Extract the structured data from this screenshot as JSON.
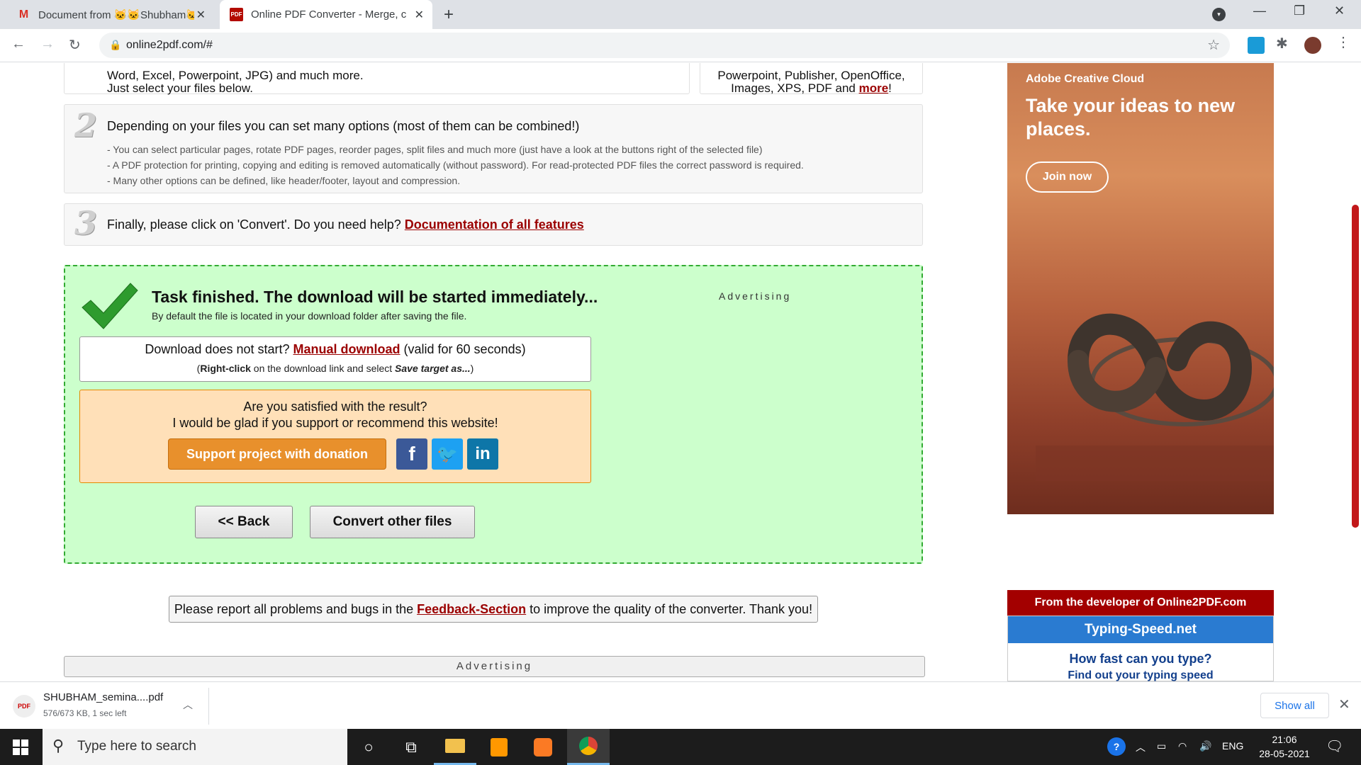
{
  "browser": {
    "tabs": [
      {
        "title": "Document from 🐱🐱Shubham🐱",
        "favicon": "M"
      },
      {
        "title": "Online PDF Converter - Merge, c",
        "favicon": "PDF"
      }
    ],
    "url": "online2pdf.com/#"
  },
  "steps": {
    "step1_line1": "Word, Excel, Powerpoint, JPG) and much more.",
    "step1_line2": "Just select your files below.",
    "step1_right_line1": "Powerpoint, Publisher, OpenOffice,",
    "step1_right_line2_prefix": "Images, XPS, PDF and ",
    "step1_right_more": "more",
    "step1_right_suffix": "!",
    "step2_num": "2",
    "step2_head": "Depending on your files you can set many options (most of them can be combined!)",
    "step2_sub1": "- You can select particular pages, rotate PDF pages, reorder pages, split files and much more (just have a look at the buttons right of the selected file)",
    "step2_sub2": "- A PDF protection for printing, copying and editing is removed automatically (without password). For read-protected PDF files the correct password is required.",
    "step2_sub3": "- Many other options can be defined, like header/footer, layout and compression.",
    "step3_num": "3",
    "step3_head": "Finally, please click on 'Convert'. Do you need help? ",
    "step3_link": "Documentation of all features"
  },
  "result": {
    "title": "Task finished. The download will be started immediately...",
    "subtitle": "By default the file is located in your download folder after saving the file.",
    "advertising": "Advertising",
    "download_prefix": "Download does not start? ",
    "download_link": "Manual download",
    "download_suffix": " (valid for 60 seconds)",
    "hint_open": "(",
    "hint_bold": "Right-click",
    "hint_mid": " on the download link and select ",
    "hint_italic": "Save target as...",
    "hint_close": ")",
    "satisfied": "Are you satisfied with the result?",
    "support_text": "I would be glad if you support or recommend this website!",
    "donate_label": "Support project with donation",
    "back_label": "<< Back",
    "convert_label": "Convert other files"
  },
  "report": {
    "prefix": "Please report all problems and bugs in the ",
    "link": "Feedback-Section",
    "suffix": " to improve the quality of the converter. Thank you!"
  },
  "advertising_bar": "Advertising",
  "adobe_ad": {
    "brand": "Adobe Creative Cloud",
    "headline": "Take your ideas to new places.",
    "cta": "Join now"
  },
  "developer_banner": "From the developer of Online2PDF.com",
  "typing": {
    "title": "Typing-Speed.net",
    "question": "How fast can you type?",
    "sub": "Find out your typing speed"
  },
  "download_shelf": {
    "filename": "SHUBHAM_semina....pdf",
    "status": "576/673 KB, 1 sec left",
    "show_all": "Show all"
  },
  "taskbar": {
    "search_placeholder": "Type here to search",
    "language": "ENG",
    "time": "21:06",
    "date": "28-05-2021"
  },
  "colors": {
    "accent_link": "#9b0000",
    "result_bg": "#ccffcc",
    "donate": "#e8902c"
  }
}
